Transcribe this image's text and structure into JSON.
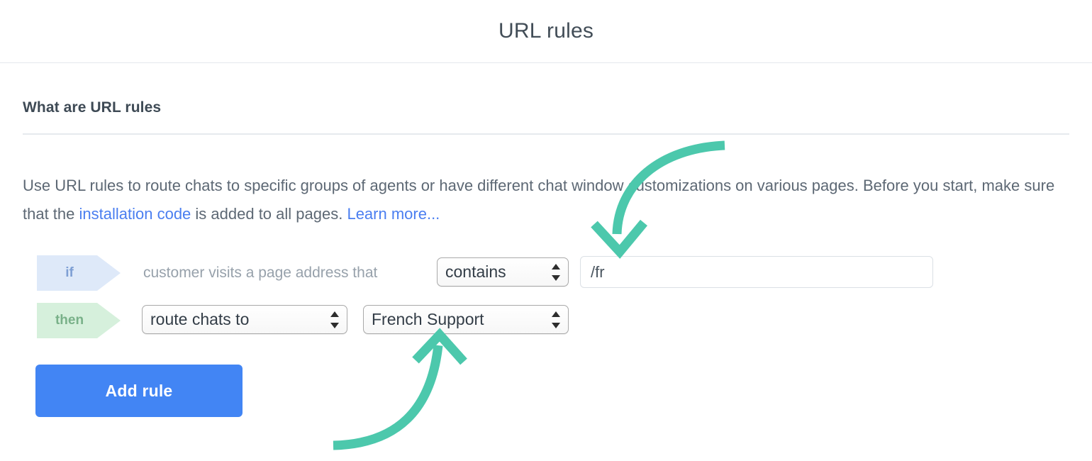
{
  "header": {
    "title": "URL rules"
  },
  "section": {
    "heading": "What are URL rules",
    "description_part1": "Use URL rules to route chats to specific groups of agents or have different chat window customizations on various pages. Before you start, make sure that the ",
    "installation_link": "installation code",
    "description_part2": " is added to all pages. ",
    "learn_more_link": "Learn more..."
  },
  "rule": {
    "if_badge": "if",
    "then_badge": "then",
    "condition_prefix": "customer visits a page address that",
    "condition_operator": "contains",
    "condition_value": "/fr",
    "condition_placeholder": "",
    "action": "route chats to",
    "action_target": "French Support",
    "add_rule_label": "Add rule"
  },
  "annotations": {
    "arrow_top_name": "arrow-pointing-to-url-value-input",
    "arrow_bottom_name": "arrow-pointing-to-group-select",
    "arrow_color": "#4cc8ac"
  },
  "colors": {
    "accent_blue": "#4285f4",
    "link_blue": "#4a7ef0",
    "if_badge_bg": "#dee9f9",
    "if_badge_text": "#7e9fd4",
    "then_badge_bg": "#d6f0dc",
    "then_badge_text": "#79b189",
    "title_text": "#424d57",
    "body_text": "#5d6874",
    "arrow_green": "#4cc8ac"
  }
}
